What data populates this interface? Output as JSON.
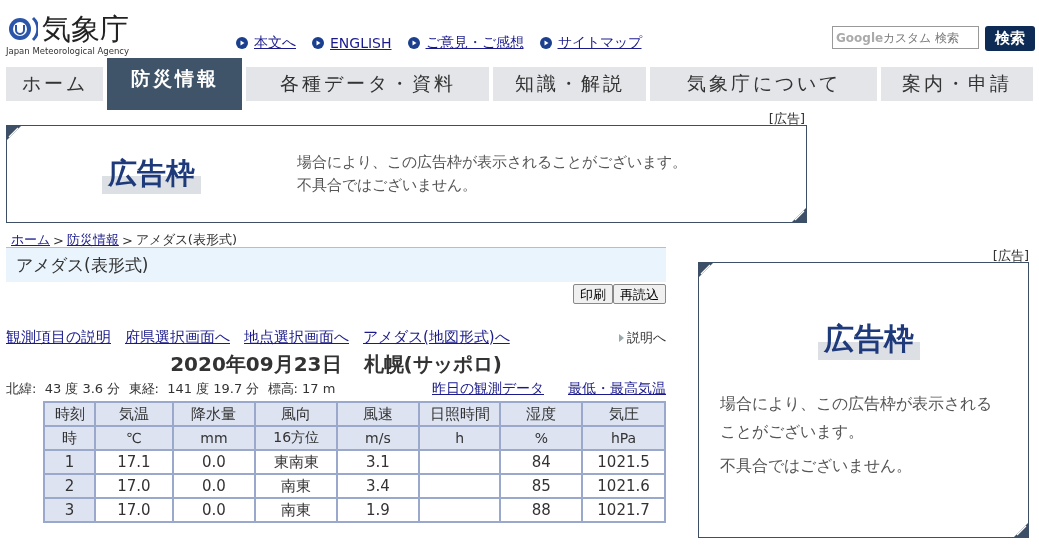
{
  "header": {
    "logo_text": "気象庁",
    "logo_subtitle": "Japan Meteorological Agency",
    "links": [
      "本文へ",
      "ENGLISH",
      "ご意見・ご感想",
      "サイトマップ"
    ],
    "search": {
      "brand": "Google",
      "placeholder": "カスタム 検索",
      "button": "検索"
    }
  },
  "nav": [
    {
      "label": "ホーム",
      "selected": false
    },
    {
      "label": "防災情報",
      "selected": true
    },
    {
      "label": "各種データ・資料",
      "selected": false
    },
    {
      "label": "知識・解説",
      "selected": false
    },
    {
      "label": "気象庁について",
      "selected": false
    },
    {
      "label": "案内・申請",
      "selected": false
    }
  ],
  "top_ad": {
    "label": "[広告]",
    "title": "広告枠",
    "lines": [
      "場合により、この広告枠が表示されることがございます。",
      "不具合ではございません。"
    ]
  },
  "breadcrumb": {
    "separator": ">",
    "items": [
      {
        "label": "ホーム",
        "link": true
      },
      {
        "label": "防災情報",
        "link": true
      },
      {
        "label": "アメダス(表形式)",
        "link": false
      }
    ]
  },
  "page_title": "アメダス(表形式)",
  "buttons": [
    "印刷",
    "再読込"
  ],
  "links": [
    "観測項目の説明",
    "府県選択画面へ",
    "地点選択画面へ",
    "アメダス(地図形式)へ"
  ],
  "help_link": "説明へ",
  "heading": {
    "date": "2020年09月23日",
    "station": "札幌(サッポロ)"
  },
  "location": "北緯:  43 度 3.6 分  東経:  141 度 19.7 分  標高: 17 m",
  "location_links": [
    "昨日の観測データ",
    "最低・最高気温"
  ],
  "table": {
    "columns": [
      {
        "name": "時刻",
        "unit": "時"
      },
      {
        "name": "気温",
        "unit": "℃"
      },
      {
        "name": "降水量",
        "unit": "mm"
      },
      {
        "name": "風向",
        "unit": "16方位"
      },
      {
        "name": "風速",
        "unit": "m/s"
      },
      {
        "name": "日照時間",
        "unit": "h"
      },
      {
        "name": "湿度",
        "unit": "%"
      },
      {
        "name": "気圧",
        "unit": "hPa"
      }
    ],
    "rows": [
      [
        "1",
        "17.1",
        "0.0",
        "東南東",
        "3.1",
        "",
        "84",
        "1021.5"
      ],
      [
        "2",
        "17.0",
        "0.0",
        "南東",
        "3.4",
        "",
        "85",
        "1021.6"
      ],
      [
        "3",
        "17.0",
        "0.0",
        "南東",
        "1.9",
        "",
        "88",
        "1021.7"
      ]
    ]
  },
  "side_ad": {
    "label": "[広告]",
    "title": "広告枠",
    "lines": [
      "場合により、この広告枠が表示されることがございます。",
      "不具合ではございません。"
    ]
  }
}
